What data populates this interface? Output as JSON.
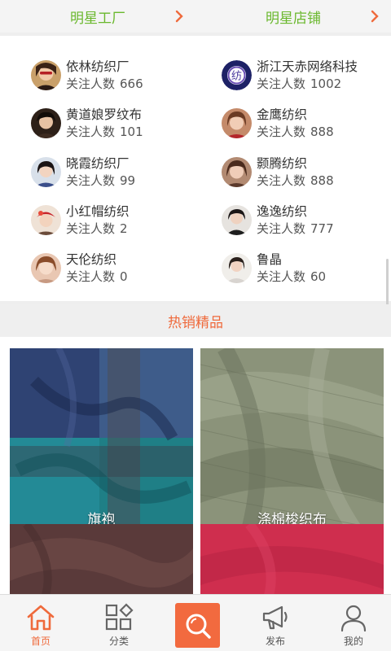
{
  "top_tabs": [
    {
      "label": "明星工厂"
    },
    {
      "label": "明星店铺"
    }
  ],
  "follow_label": "关注人数",
  "factories": [
    {
      "name": "依林纺织厂",
      "count": "666"
    },
    {
      "name": "黄道娘罗纹布",
      "count": "101"
    },
    {
      "name": "晓霞纺织厂",
      "count": "99"
    },
    {
      "name": "小红帽纺织",
      "count": "2"
    },
    {
      "name": "天伦纺织",
      "count": "0"
    }
  ],
  "stores": [
    {
      "name": "浙江天赤网络科技",
      "count": "1002",
      "logo_text": "纺"
    },
    {
      "name": "金鹰纺织",
      "count": "888"
    },
    {
      "name": "颢腾纺织",
      "count": "888"
    },
    {
      "name": "逸逸纺织",
      "count": "777"
    },
    {
      "name": "鲁晶",
      "count": "60"
    }
  ],
  "hot_section": {
    "title": "热销精品"
  },
  "products": [
    {
      "name": "旗袍"
    },
    {
      "name": "涤棉梭织布"
    },
    {
      "name": ""
    },
    {
      "name": ""
    }
  ],
  "bottom_nav": [
    {
      "label": "首页",
      "icon": "home-icon",
      "active": true
    },
    {
      "label": "分类",
      "icon": "category-icon"
    },
    {
      "label": "",
      "icon": "search-icon"
    },
    {
      "label": "发布",
      "icon": "megaphone-icon"
    },
    {
      "label": "我的",
      "icon": "user-icon"
    }
  ],
  "colors": {
    "accent_green": "#6ab82d",
    "accent_orange": "#f26a3f",
    "text_dark": "#333333"
  }
}
